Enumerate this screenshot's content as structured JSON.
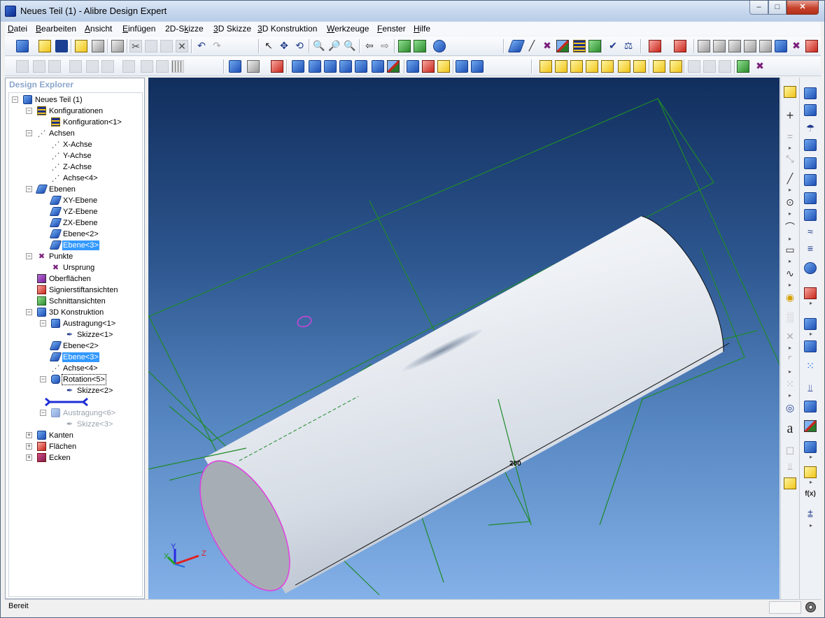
{
  "window": {
    "title": "Neues Teil (1) - Alibre Design Expert"
  },
  "menu": [
    {
      "pre": "",
      "u": "D",
      "post": "atei"
    },
    {
      "pre": "",
      "u": "B",
      "post": "earbeiten"
    },
    {
      "pre": "",
      "u": "A",
      "post": "nsicht"
    },
    {
      "pre": "",
      "u": "E",
      "post": "infügen"
    },
    {
      "pre": "2D-S",
      "u": "k",
      "post": "izze"
    },
    {
      "pre": "",
      "u": "3",
      "post": "D Skizze"
    },
    {
      "pre": "",
      "u": "3",
      "post": "D Konstruktion"
    },
    {
      "pre": "",
      "u": "W",
      "post": "erkzeuge"
    },
    {
      "pre": "",
      "u": "F",
      "post": "enster"
    },
    {
      "pre": "",
      "u": "H",
      "post": "ilfe"
    }
  ],
  "explorer": {
    "title": "Design Explorer",
    "root": "Neues Teil (1)",
    "config_group": "Konfigurationen",
    "config_item": "Konfiguration<1>",
    "axes_group": "Achsen",
    "axes": [
      "X-Achse",
      "Y-Achse",
      "Z-Achse",
      "Achse<4>"
    ],
    "planes_group": "Ebenen",
    "planes": [
      "XY-Ebene",
      "YZ-Ebene",
      "ZX-Ebene",
      "Ebene<2>",
      "Ebene<3>"
    ],
    "points_group": "Punkte",
    "origin": "Ursprung",
    "surfaces": "Oberflächen",
    "redline": "Signierstiftansichten",
    "sections": "Schnittansichten",
    "construction_group": "3D Konstruktion",
    "extrude1": "Austragung<1>",
    "sketch1": "Skizze<1>",
    "feat_plane2": "Ebene<2>",
    "feat_plane3": "Ebene<3>",
    "feat_axis4": "Achse<4>",
    "revolve5": "Rotation<5>",
    "sketch2": "Skizze<2>",
    "extrude6": "Austragung<6>",
    "sketch3": "Skizze<3>",
    "edges": "Kanten",
    "faces": "Flächen",
    "vertices": "Ecken"
  },
  "viewport": {
    "dimension_label": "200",
    "triad": {
      "x": "X",
      "y": "Y",
      "z": "Z"
    }
  },
  "colors": {
    "part_body": "#e8ecf2",
    "plane_lines": "#1f8a2a",
    "sketch_highlight": "#e040e0",
    "selection": "#3399ff"
  },
  "right_toolbar": {
    "text_tool": "a",
    "function_tool": "f(x)"
  },
  "status": {
    "text": "Bereit"
  }
}
